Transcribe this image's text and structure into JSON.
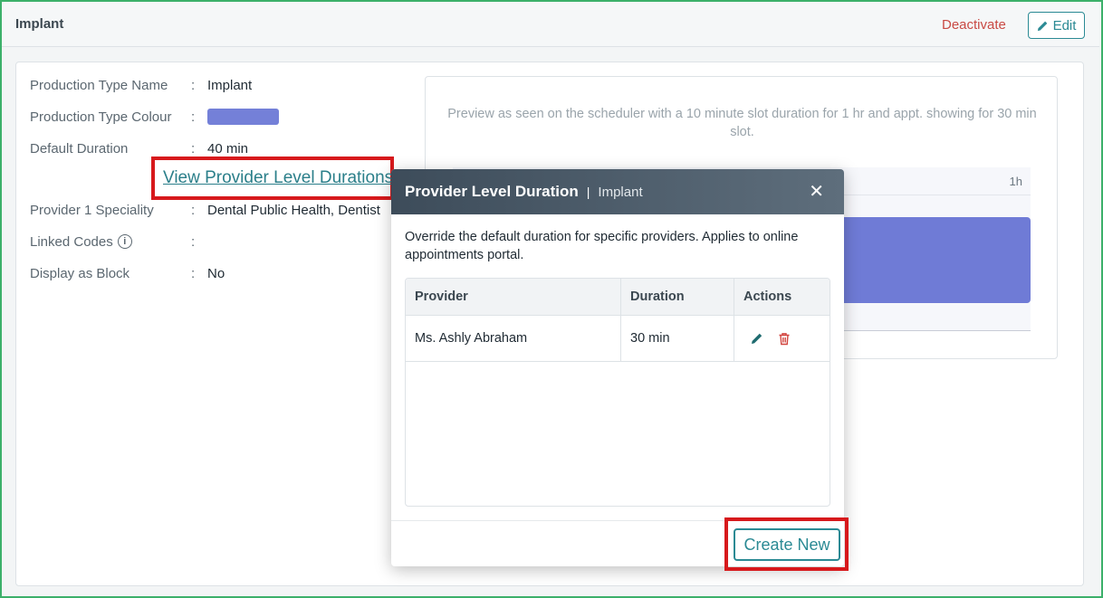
{
  "header": {
    "title": "Implant",
    "deactivate_label": "Deactivate",
    "edit_label": "Edit"
  },
  "details": {
    "production_type_name": {
      "label": "Production Type Name",
      "value": "Implant"
    },
    "production_type_colour": {
      "label": "Production Type Colour",
      "color": "#7480d8"
    },
    "default_duration": {
      "label": "Default Duration",
      "value": "40 min"
    },
    "view_provider_link": "View Provider Level Durations",
    "provider_speciality": {
      "label": "Provider 1 Speciality",
      "value": "Dental Public Health, Dentist"
    },
    "linked_codes": {
      "label": "Linked Codes",
      "value": ""
    },
    "display_as_block": {
      "label": "Display as Block",
      "value": "No"
    },
    "colon": ":"
  },
  "preview": {
    "text": "Preview as seen on the scheduler with a 10 minute slot duration for 1 hr and appt. showing for 30 min slot.",
    "hour_label": "1h",
    "block_color": "#6f7bd6"
  },
  "modal": {
    "title": "Provider Level Duration",
    "separator": "|",
    "subtitle": "Implant",
    "description": "Override the default duration for specific providers. Applies to online appointments portal.",
    "table": {
      "headers": {
        "provider": "Provider",
        "duration": "Duration",
        "actions": "Actions"
      },
      "rows": [
        {
          "provider": "Ms. Ashly Abraham",
          "duration": "30 min"
        }
      ]
    },
    "create_label": "Create New"
  },
  "colors": {
    "accent": "#2b8a94",
    "danger": "#c94a44",
    "highlight": "#d7191c",
    "frame": "#3cb06a"
  }
}
